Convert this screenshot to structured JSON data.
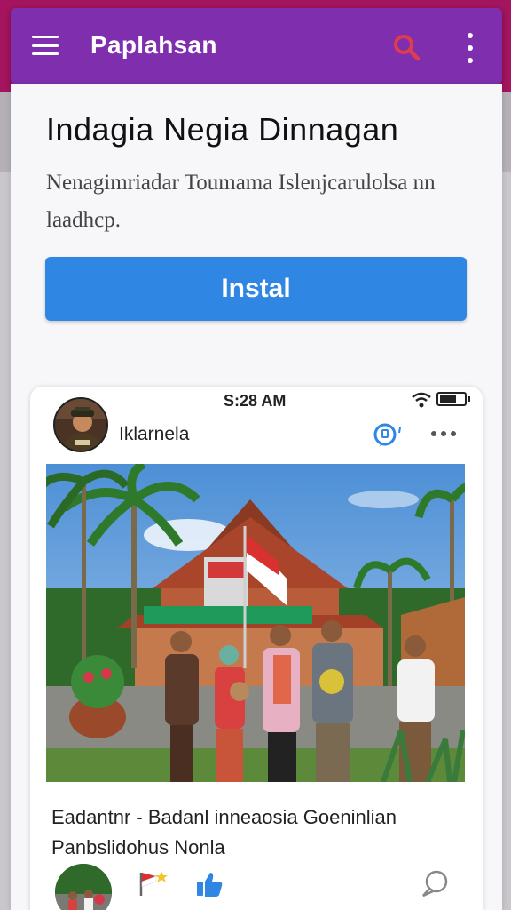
{
  "app": {
    "title": "Paplahsan"
  },
  "hero": {
    "headline": "Indagia Negia Dinnagan",
    "description": "Nenagimriadar Toumama Islenjcarulolsa nn laadhcp.",
    "install_label": "Instal"
  },
  "post": {
    "status_time": "S:28 AM",
    "author": "Iklarnela",
    "caption": "Eadantnr - Badanl inneaosia Goeninlian Panbslidohus Nonla"
  },
  "colors": {
    "top_bar": "#a4145f",
    "app_bar": "#7f2fae",
    "search_icon": "#e03c4b",
    "install_button": "#2f86e3",
    "like_icon": "#2f86e3"
  }
}
